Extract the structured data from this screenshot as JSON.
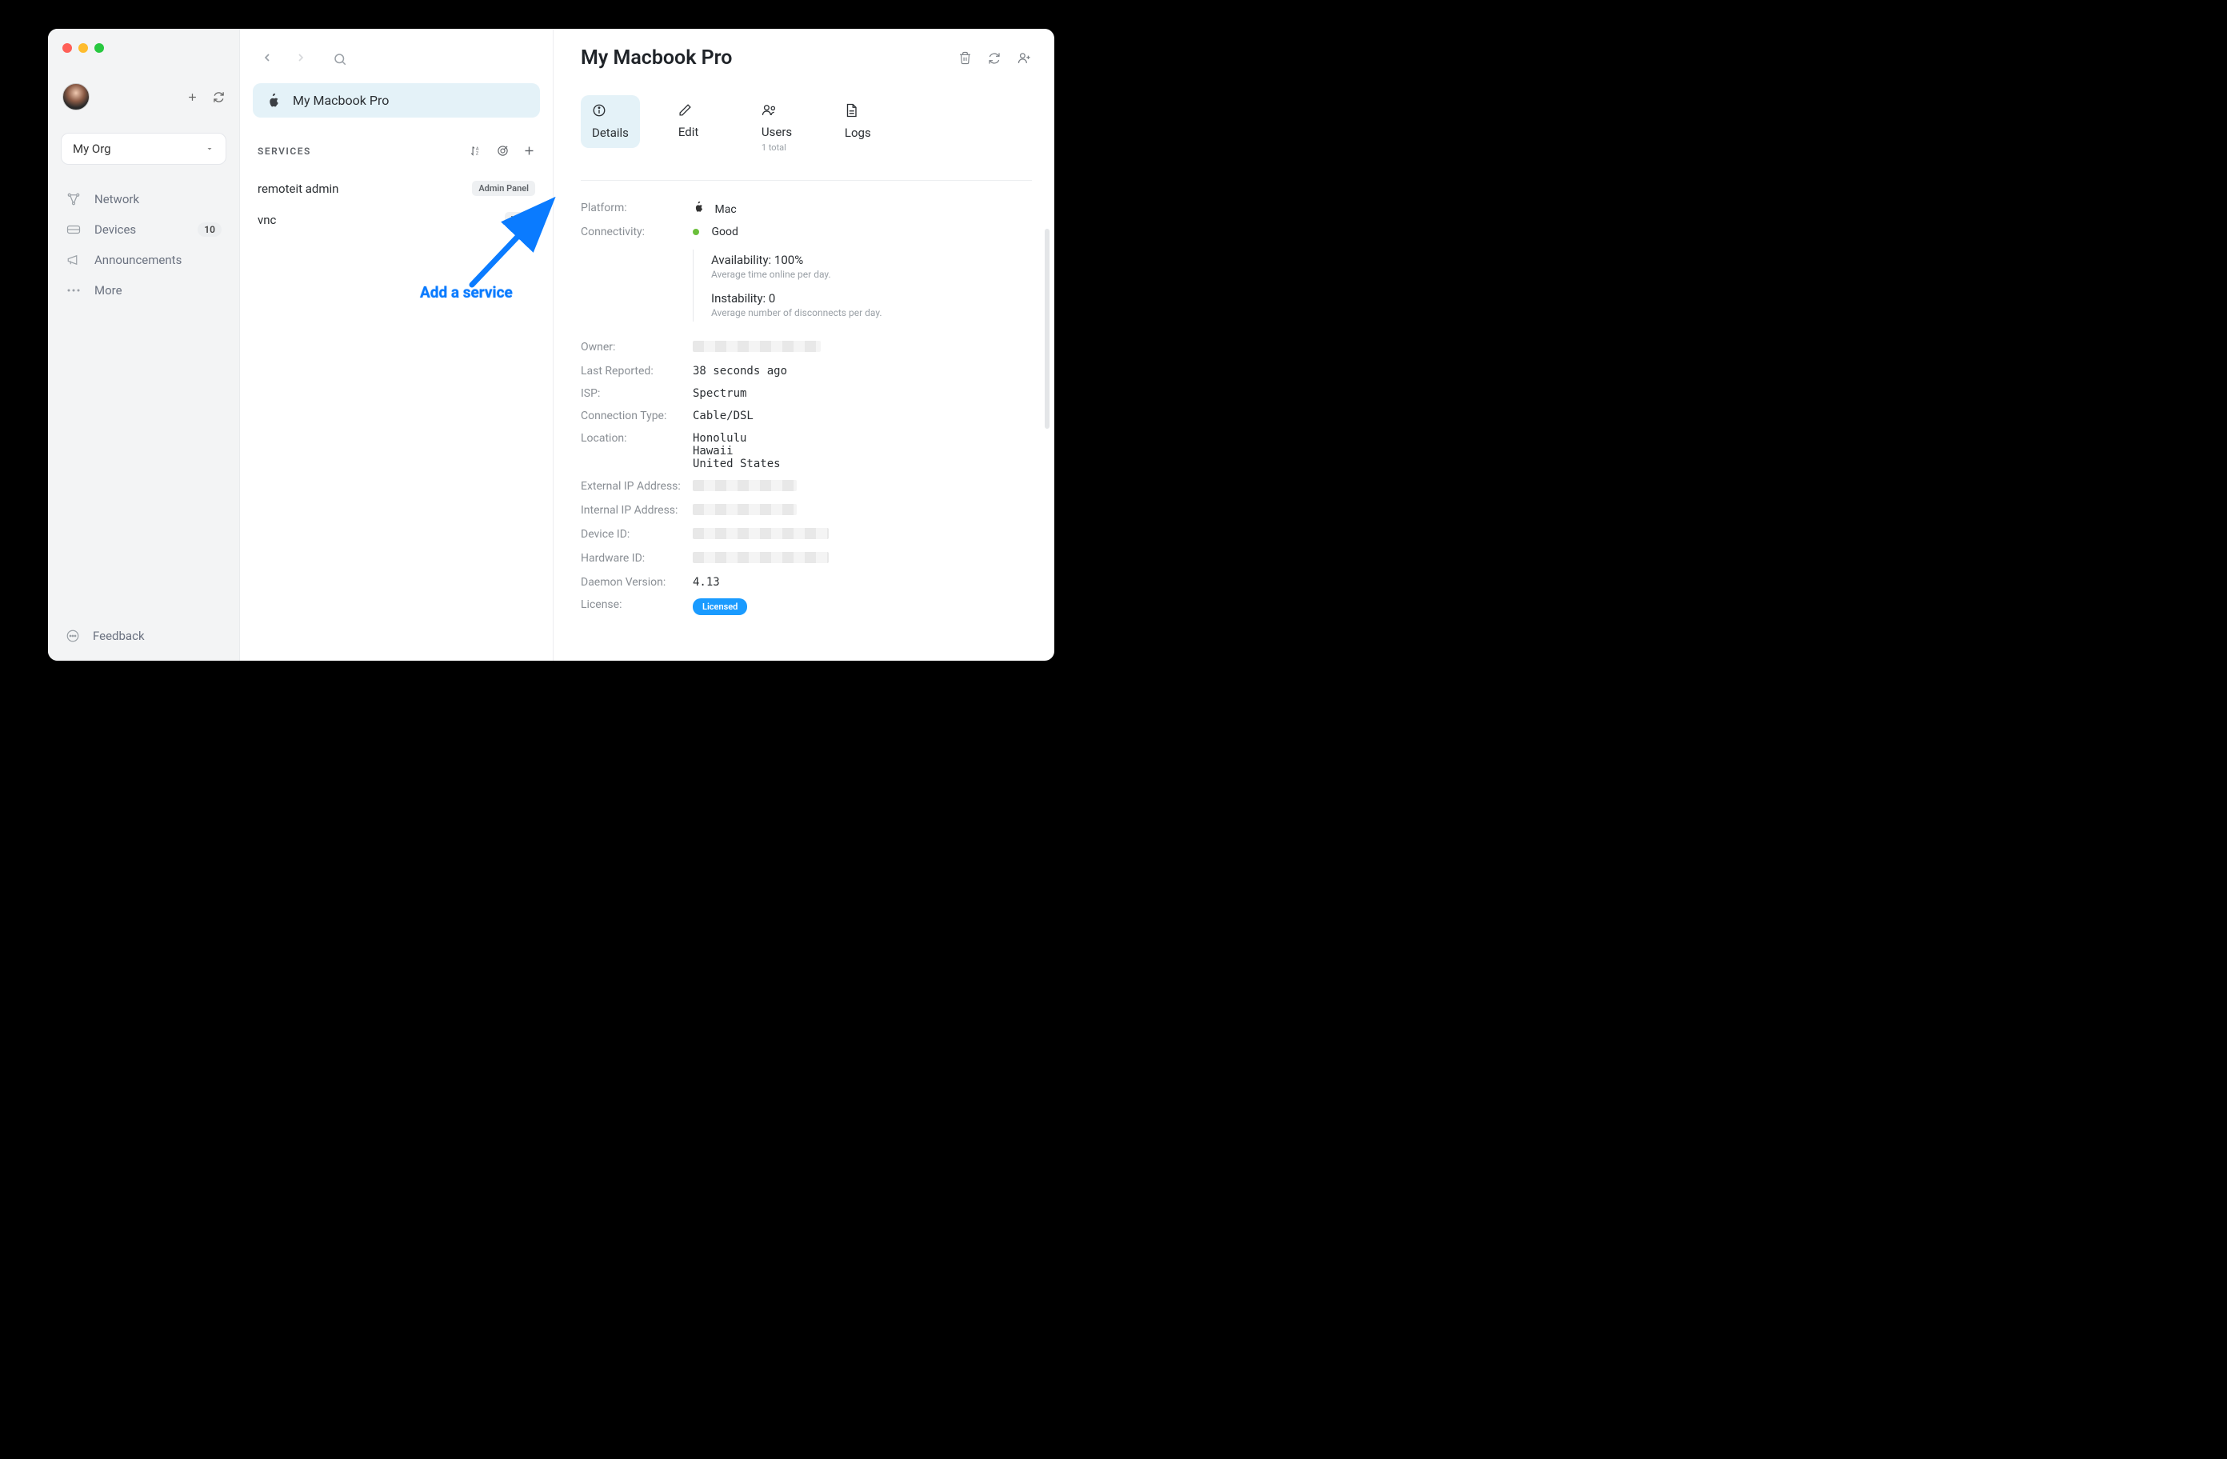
{
  "org": {
    "name": "My Org"
  },
  "sidebar": {
    "items": [
      {
        "label": "Network"
      },
      {
        "label": "Devices",
        "badge": "10"
      },
      {
        "label": "Announcements"
      },
      {
        "label": "More"
      }
    ],
    "feedback": "Feedback"
  },
  "middle": {
    "device_name": "My Macbook Pro",
    "services_label": "SERVICES",
    "services": [
      {
        "name": "remoteit admin",
        "tag": "Admin Panel"
      },
      {
        "name": "vnc",
        "tag": "VNC"
      }
    ]
  },
  "annotation": "Add a service",
  "main": {
    "title": "My Macbook Pro",
    "tabs": {
      "details": "Details",
      "edit": "Edit",
      "users": "Users",
      "users_sub": "1 total",
      "logs": "Logs"
    },
    "details": {
      "platform_label": "Platform:",
      "platform_value": "Mac",
      "connectivity_label": "Connectivity:",
      "connectivity_value": "Good",
      "availability": "Availability: 100%",
      "availability_sub": "Average time online per day.",
      "instability": "Instability: 0",
      "instability_sub": "Average number of disconnects per day.",
      "owner_label": "Owner:",
      "last_reported_label": "Last Reported:",
      "last_reported_value": "38 seconds ago",
      "isp_label": "ISP:",
      "isp_value": "Spectrum",
      "conn_type_label": "Connection Type:",
      "conn_type_value": "Cable/DSL",
      "location_label": "Location:",
      "location_value_1": "Honolulu",
      "location_value_2": "Hawaii",
      "location_value_3": "United States",
      "ext_ip_label": "External IP Address:",
      "int_ip_label": "Internal IP Address:",
      "device_id_label": "Device ID:",
      "hardware_id_label": "Hardware ID:",
      "daemon_label": "Daemon Version:",
      "daemon_value": "4.13",
      "license_label": "License:",
      "license_value": "Licensed"
    }
  }
}
